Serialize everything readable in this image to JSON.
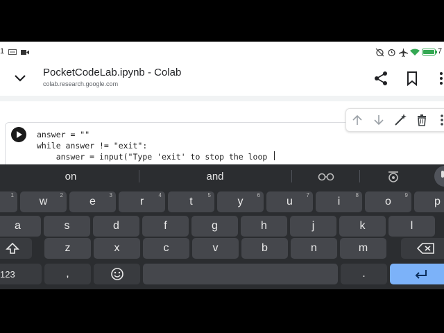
{
  "status_bar": {
    "time_partial": "1",
    "battery_partial": "7"
  },
  "app_bar": {
    "title": "PocketCodeLab.ipynb - Colab",
    "subtitle": "colab.research.google.com"
  },
  "cell": {
    "code_lines": [
      "answer = \"\"",
      "while answer != \"exit\":",
      "    answer = input(\"Type 'exit' to stop the loop "
    ]
  },
  "keyboard": {
    "suggestions": [
      "on",
      "and"
    ],
    "row1": [
      {
        "label": "",
        "num": "1"
      },
      {
        "label": "w",
        "num": "2"
      },
      {
        "label": "e",
        "num": "3"
      },
      {
        "label": "r",
        "num": "4"
      },
      {
        "label": "t",
        "num": "5"
      },
      {
        "label": "y",
        "num": "6"
      },
      {
        "label": "u",
        "num": "7"
      },
      {
        "label": "i",
        "num": "8"
      },
      {
        "label": "o",
        "num": "9"
      },
      {
        "label": "p",
        "num": ""
      }
    ],
    "row2": [
      "a",
      "s",
      "d",
      "f",
      "g",
      "h",
      "j",
      "k",
      "l"
    ],
    "row3": [
      "z",
      "x",
      "c",
      "v",
      "b",
      "n",
      "m"
    ],
    "symbols_key": "123",
    "comma_key": ",",
    "period_key": "."
  },
  "colors": {
    "keyboard_bg": "#2b2d30",
    "key_bg": "#45474c",
    "enter_bg": "#7cb2f9",
    "battery_green": "#34a853"
  }
}
